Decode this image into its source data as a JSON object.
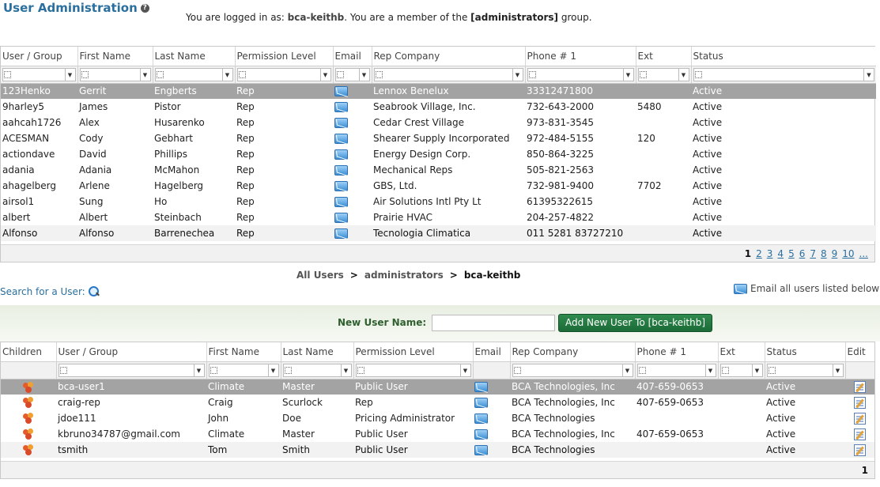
{
  "header": {
    "title": "User Administration",
    "help_symbol": "?",
    "login_prefix": "You are logged in as: ",
    "login_user": "bca-keithb",
    "login_mid": ". You are a member of the ",
    "login_group": "[administrators]",
    "login_suffix": " group."
  },
  "top_grid": {
    "columns": [
      "User / Group",
      "First Name",
      "Last Name",
      "Permission Level",
      "Email",
      "Rep Company",
      "Phone # 1",
      "Ext",
      "Status"
    ],
    "rows": [
      {
        "user": "123Henko",
        "first": "Gerrit",
        "last": "Engberts",
        "perm": "Rep",
        "company": "Lennox Benelux",
        "phone": "33312471800",
        "ext": "",
        "status": "Active"
      },
      {
        "user": "9harley5",
        "first": "James",
        "last": "Pistor",
        "perm": "Rep",
        "company": "Seabrook Village, Inc.",
        "phone": "732-643-2000",
        "ext": "5480",
        "status": "Active"
      },
      {
        "user": "aahcah1726",
        "first": "Alex",
        "last": "Husarenko",
        "perm": "Rep",
        "company": "Cedar Crest Village",
        "phone": "973-831-3545",
        "ext": "",
        "status": "Active"
      },
      {
        "user": "ACESMAN",
        "first": "Cody",
        "last": "Gebhart",
        "perm": "Rep",
        "company": "Shearer Supply Incorporated",
        "phone": "972-484-5155",
        "ext": "120",
        "status": "Active"
      },
      {
        "user": "actiondave",
        "first": "David",
        "last": "Phillips",
        "perm": "Rep",
        "company": "Energy Design Corp.",
        "phone": "850-864-3225",
        "ext": "",
        "status": "Active"
      },
      {
        "user": "adania",
        "first": "Adania",
        "last": "McMahon",
        "perm": "Rep",
        "company": "Mechanical Reps",
        "phone": "505-821-2563",
        "ext": "",
        "status": "Active"
      },
      {
        "user": "ahagelberg",
        "first": "Arlene",
        "last": "Hagelberg",
        "perm": "Rep",
        "company": "GBS, Ltd.",
        "phone": "732-981-9400",
        "ext": "7702",
        "status": "Active"
      },
      {
        "user": "airsol1",
        "first": "Sung",
        "last": "Ho",
        "perm": "Rep",
        "company": "Air Solutions Intl Pty Lt",
        "phone": "61395322615",
        "ext": "",
        "status": "Active"
      },
      {
        "user": "albert",
        "first": "Albert",
        "last": "Steinbach",
        "perm": "Rep",
        "company": "Prairie HVAC",
        "phone": "204-257-4822",
        "ext": "",
        "status": "Active"
      },
      {
        "user": "Alfonso",
        "first": "Alfonso",
        "last": "Barrenechea",
        "perm": "Rep",
        "company": "Tecnologia Climatica",
        "phone": "011 5281 83727210",
        "ext": "",
        "status": "Active"
      }
    ],
    "pager": {
      "current": "1",
      "pages": [
        "2",
        "3",
        "4",
        "5",
        "6",
        "7",
        "8",
        "9",
        "10",
        "..."
      ]
    }
  },
  "breadcrumb": {
    "root": "All Users",
    "sep": ">",
    "group": "administrators",
    "current": "bca-keithb"
  },
  "search_link": "Search for a User:",
  "email_all_label": "Email all users listed below",
  "add_user": {
    "label": "New User Name:",
    "input_value": "",
    "button_label": "Add New User To [bca-keithb]"
  },
  "bottom_grid": {
    "columns": [
      "Children",
      "User / Group",
      "First Name",
      "Last Name",
      "Permission Level",
      "Email",
      "Rep Company",
      "Phone # 1",
      "Ext",
      "Status",
      "Edit"
    ],
    "rows": [
      {
        "user": "bca-user1",
        "first": "Climate",
        "last": "Master",
        "perm": "Public User",
        "company": "BCA Technologies, Inc",
        "phone": "407-659-0653",
        "ext": "",
        "status": "Active"
      },
      {
        "user": "craig-rep",
        "first": "Craig",
        "last": "Scurlock",
        "perm": "Rep",
        "company": "BCA Technologies, Inc",
        "phone": "407-659-0653",
        "ext": "",
        "status": "Active"
      },
      {
        "user": "jdoe111",
        "first": "John",
        "last": "Doe",
        "perm": "Pricing Administrator",
        "company": "BCA Technologies",
        "phone": "",
        "ext": "",
        "status": "Active"
      },
      {
        "user": "kbruno34787@gmail.com",
        "first": "Climate",
        "last": "Master",
        "perm": "Public User",
        "company": "BCA Technologies, Inc",
        "phone": "407-659-0653",
        "ext": "",
        "status": "Active"
      },
      {
        "user": "tsmith",
        "first": "Tom",
        "last": "Smith",
        "perm": "Public User",
        "company": "BCA Technologies",
        "phone": "",
        "ext": "",
        "status": "Active"
      }
    ],
    "pager": {
      "current": "1"
    }
  },
  "colors": {
    "accent": "#2a6f9e",
    "selected_row": "#a3a3a3",
    "add_button": "#1b6b37"
  }
}
